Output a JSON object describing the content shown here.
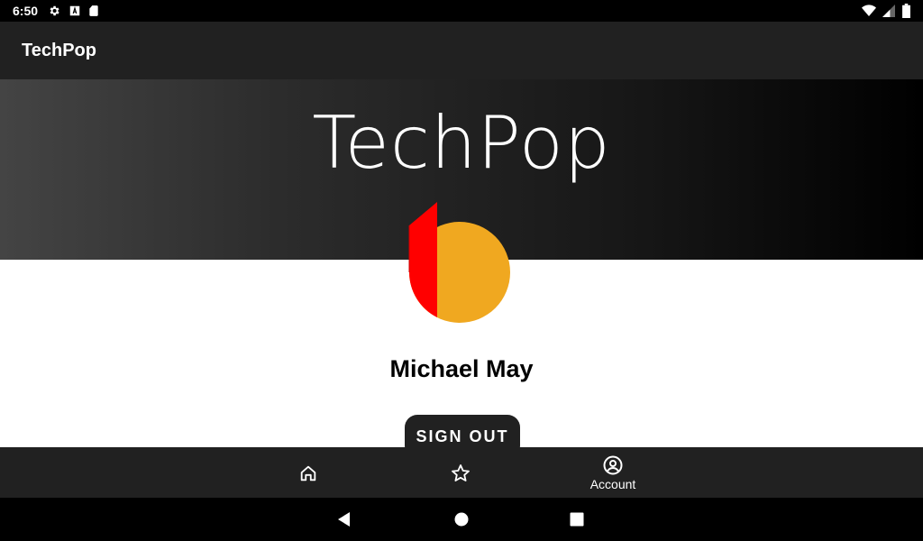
{
  "status_bar": {
    "time": "6:50",
    "left_icons": [
      "gear-icon",
      "font-a-icon",
      "sd-card-icon"
    ],
    "right_icons": [
      "wifi-icon",
      "cell-signal-icon",
      "battery-icon"
    ]
  },
  "app_bar": {
    "title": "TechPop"
  },
  "header": {
    "title": "TechPop"
  },
  "profile": {
    "name": "Michael May",
    "avatar_colors": {
      "red": "#ff0000",
      "orange": "#f0a820"
    },
    "sign_out_label": "SIGN OUT"
  },
  "bottom_nav": {
    "items": [
      {
        "icon": "home-icon",
        "label": ""
      },
      {
        "icon": "star-icon",
        "label": ""
      },
      {
        "icon": "account-icon",
        "label": "Account",
        "selected": true
      }
    ]
  },
  "system_nav": {
    "buttons": [
      "back-icon",
      "home-circle-icon",
      "recents-icon"
    ]
  },
  "colors": {
    "app_bar": "#212121",
    "content_bg": "#ffffff",
    "text_primary": "#000000"
  }
}
